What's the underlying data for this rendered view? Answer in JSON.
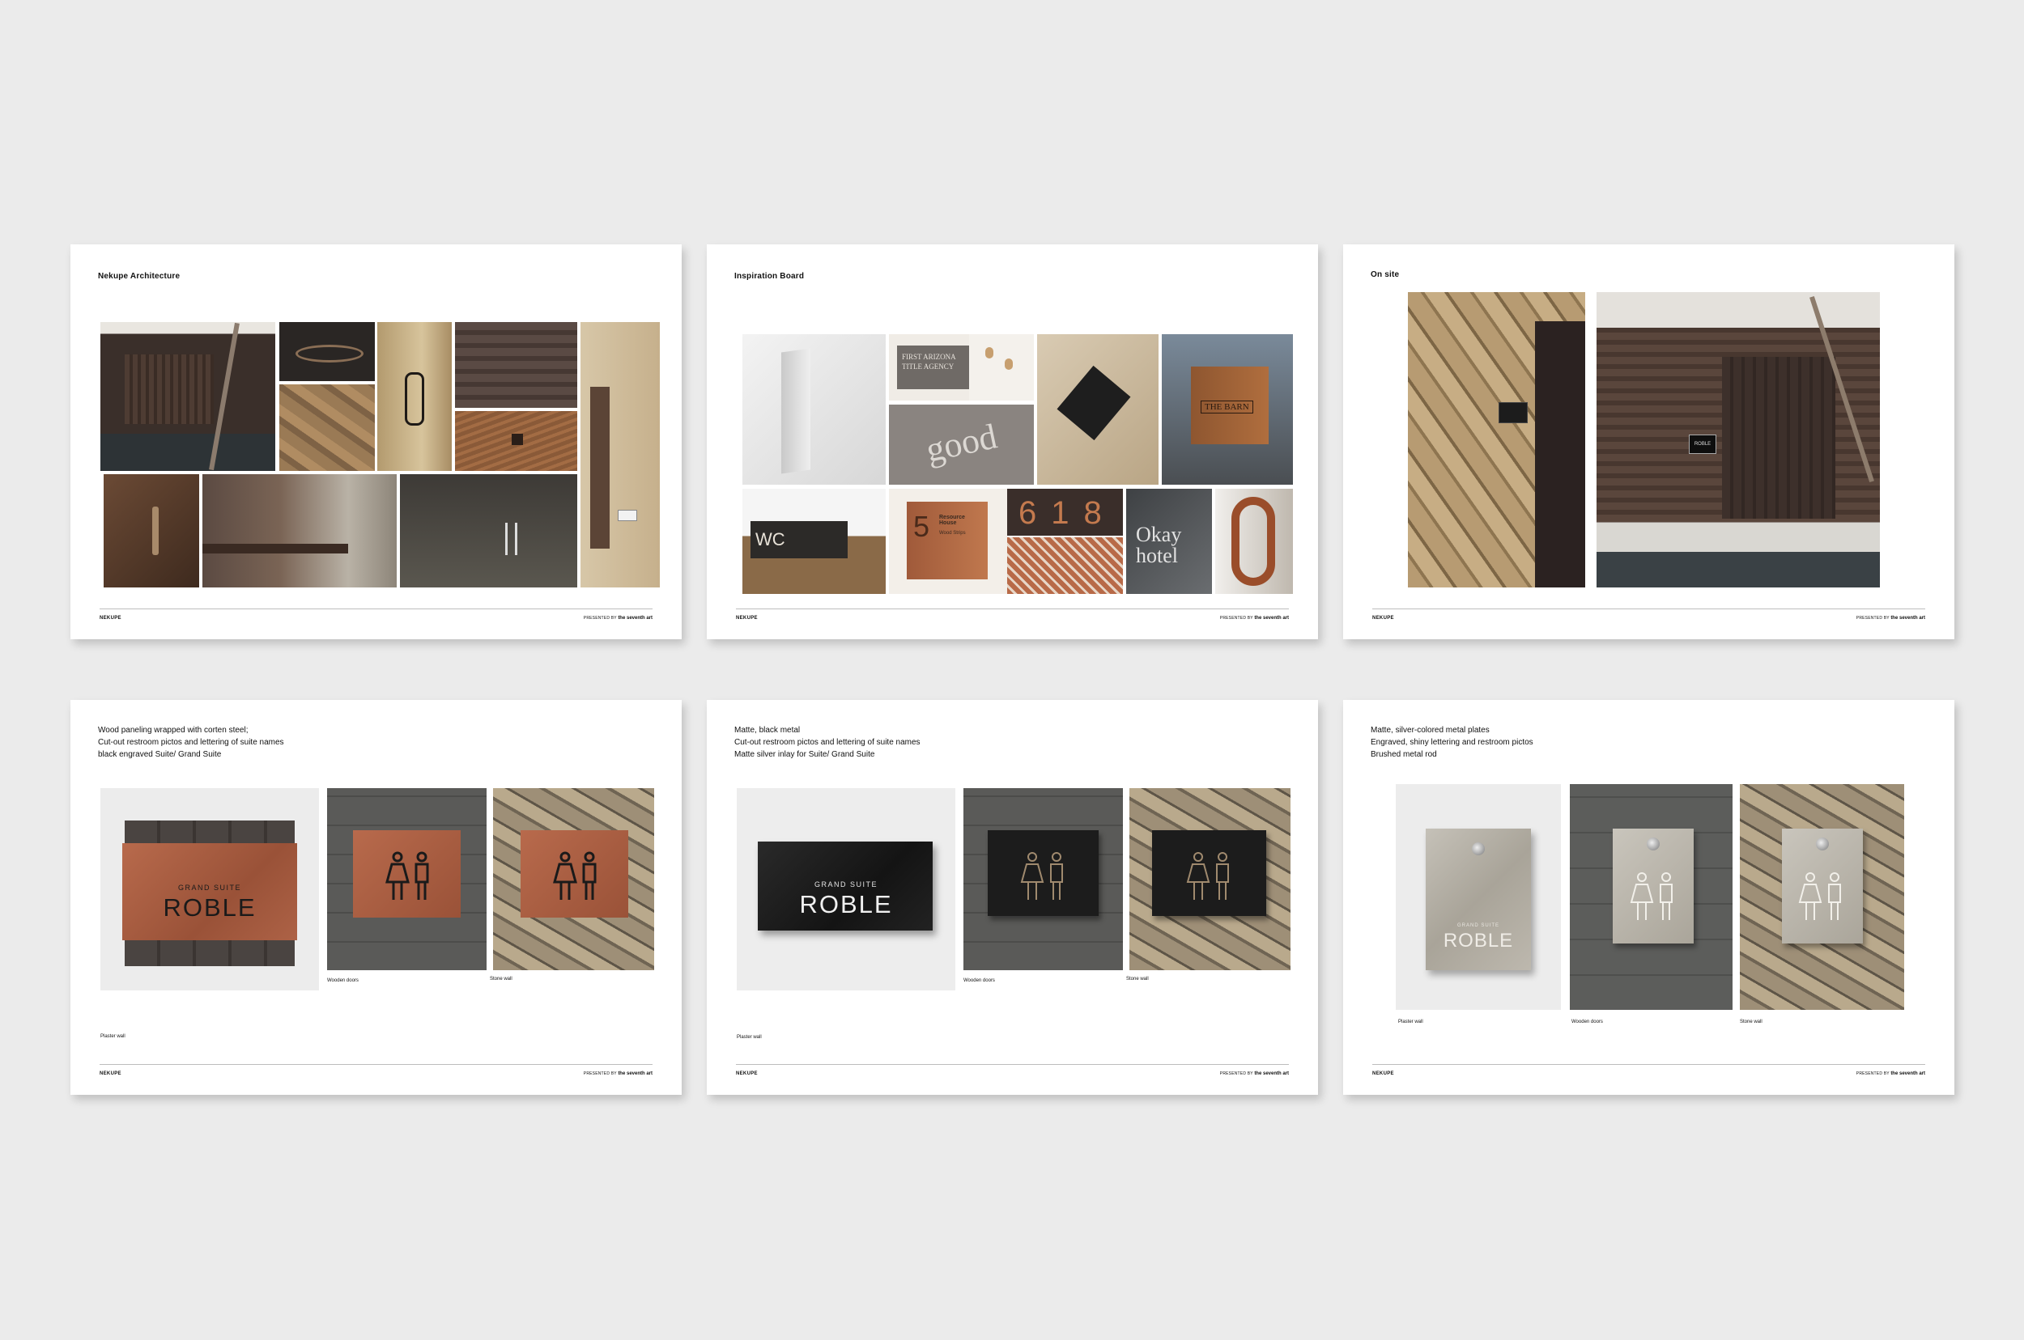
{
  "footer": {
    "brand": "NEKUPE",
    "presented_by": "PRESENTED BY",
    "studio": "the seventh art"
  },
  "slides": [
    {
      "title": "Nekupe Architecture"
    },
    {
      "title": "Inspiration Board"
    },
    {
      "title": "On site"
    },
    {
      "lines": [
        "Wood paneling wrapped with corten steel;",
        "Cut-out restroom pictos and lettering of suite names",
        "black engraved Suite/ Grand Suite"
      ],
      "captions": [
        "Plaster wall",
        "Wooden doors",
        "Stone wall"
      ]
    },
    {
      "lines": [
        "Matte, black metal",
        "Cut-out restroom pictos and lettering of suite names",
        "Matte silver inlay for Suite/ Grand Suite"
      ],
      "captions": [
        "Plaster wall",
        "Wooden doors",
        "Stone wall"
      ]
    },
    {
      "lines": [
        "Matte, silver-colored metal plates",
        "Engraved, shiny lettering and restroom pictos",
        "Brushed metal rod"
      ],
      "captions": [
        "Plaster wall",
        "Wooden doors",
        "Stone wall"
      ]
    }
  ],
  "inspiration": {
    "title_agency": "FIRST ARIZONA TITLE AGENCY",
    "good": "good",
    "barn": "THE BARN",
    "wc": "WC",
    "five": "5",
    "resource": "Resource House",
    "resource_sub": "Wood Strips",
    "numbers": "618",
    "hotel": "Okay hotel"
  },
  "onsite": {
    "plate": "ROBLE"
  },
  "sign": {
    "subtitle": "GRAND SUITE",
    "name": "ROBLE"
  }
}
